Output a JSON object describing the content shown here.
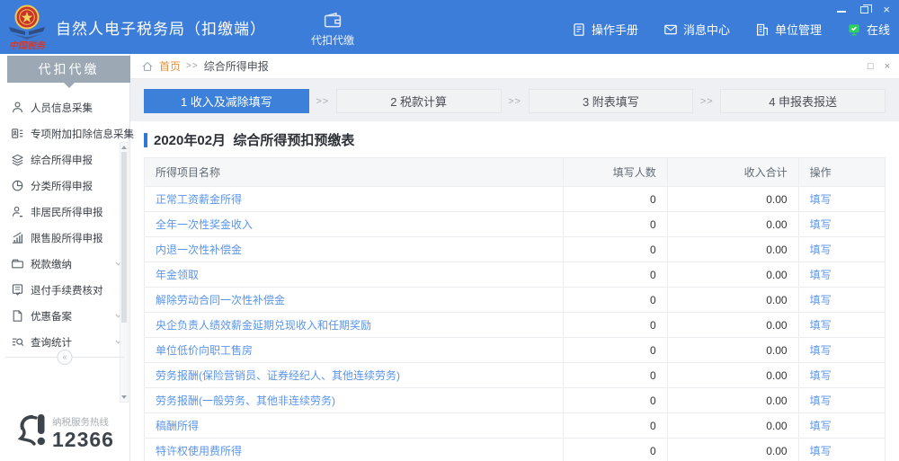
{
  "header": {
    "title": "自然人电子税务局（扣缴端）",
    "logo_text": "中国税务",
    "nav_tab": {
      "name": "withholding",
      "label": "代扣代缴",
      "icon": "wallet-icon"
    },
    "menu": [
      {
        "name": "operation-manual",
        "label": "操作手册",
        "icon": "manual-icon"
      },
      {
        "name": "message-center",
        "label": "消息中心",
        "icon": "message-icon"
      },
      {
        "name": "unit-management",
        "label": "单位管理",
        "icon": "building-icon"
      },
      {
        "name": "online-status",
        "label": "在线",
        "icon": "online-icon"
      }
    ]
  },
  "sidebar": {
    "title": "代扣代缴",
    "items": [
      {
        "name": "personnel-info-collection",
        "label": "人员信息采集",
        "icon": "person-icon",
        "expandable": false
      },
      {
        "name": "special-deduction-collection",
        "label": "专项附加扣除信息采集",
        "icon": "id-list-icon",
        "expandable": false
      },
      {
        "name": "comprehensive-income-declaration",
        "label": "综合所得申报",
        "icon": "layers-icon",
        "expandable": false
      },
      {
        "name": "classified-income-declaration",
        "label": "分类所得申报",
        "icon": "pie-chart-icon",
        "expandable": false
      },
      {
        "name": "nonresident-income-declaration",
        "label": "非居民所得申报",
        "icon": "person-tag-icon",
        "expandable": false
      },
      {
        "name": "restricted-stock-declaration",
        "label": "限售股所得申报",
        "icon": "bar-chart-icon",
        "expandable": false
      },
      {
        "name": "tax-payment",
        "label": "税款缴纳",
        "icon": "folder-icon",
        "expandable": true
      },
      {
        "name": "refund-fee-check",
        "label": "退付手续费核对",
        "icon": "receipt-icon",
        "expandable": false
      },
      {
        "name": "preferential-filing",
        "label": "优惠备案",
        "icon": "file-icon",
        "expandable": true
      },
      {
        "name": "query-statistics",
        "label": "查询统计",
        "icon": "search-list-icon",
        "expandable": true
      }
    ],
    "collapse_glyph": "«",
    "hotline": {
      "label": "纳税服务热线",
      "number": "12366"
    }
  },
  "breadcrumb": {
    "home": "首页",
    "separator": ">>",
    "current": "综合所得申报"
  },
  "steps_separator": ">>",
  "steps": [
    {
      "label": "1 收入及减除填写",
      "active": true
    },
    {
      "label": "2 税款计算",
      "active": false
    },
    {
      "label": "3 附表填写",
      "active": false
    },
    {
      "label": "4 申报表报送",
      "active": false
    }
  ],
  "table": {
    "title": "2020年02月  综合所得预扣预缴表",
    "columns": [
      "所得项目名称",
      "填写人数",
      "收入合计",
      "操作"
    ],
    "action_label": "填写",
    "rows": [
      {
        "name": "正常工资薪金所得",
        "count": "0",
        "total": "0.00"
      },
      {
        "name": "全年一次性奖金收入",
        "count": "0",
        "total": "0.00"
      },
      {
        "name": "内退一次性补偿金",
        "count": "0",
        "total": "0.00"
      },
      {
        "name": "年金领取",
        "count": "0",
        "total": "0.00"
      },
      {
        "name": "解除劳动合同一次性补偿金",
        "count": "0",
        "total": "0.00"
      },
      {
        "name": "央企负责人绩效薪金延期兑现收入和任期奖励",
        "count": "0",
        "total": "0.00"
      },
      {
        "name": "单位低价向职工售房",
        "count": "0",
        "total": "0.00"
      },
      {
        "name": "劳务报酬(保险营销员、证券经纪人、其他连续劳务)",
        "count": "0",
        "total": "0.00"
      },
      {
        "name": "劳务报酬(一般劳务、其他非连续劳务)",
        "count": "0",
        "total": "0.00"
      },
      {
        "name": "稿酬所得",
        "count": "0",
        "total": "0.00"
      },
      {
        "name": "特许权使用费所得",
        "count": "0",
        "total": "0.00"
      }
    ]
  },
  "colors": {
    "header_blue": "#3d7dda",
    "active_step_blue": "#3c80da",
    "link_blue": "#5b95e8",
    "online_green": "#2fd060",
    "breadcrumb_home_orange": "#df923f",
    "sidebar_header_gray": "#9ca9b4"
  }
}
